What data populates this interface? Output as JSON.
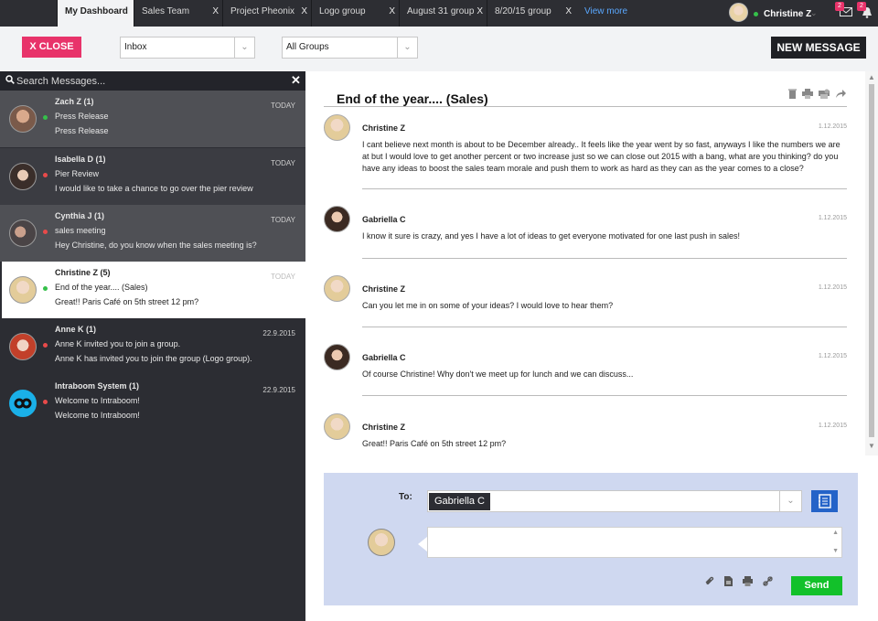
{
  "tabs": [
    {
      "label": "My Dashboard",
      "closable": false
    },
    {
      "label": "Sales Team",
      "close": "X"
    },
    {
      "label": "Project Pheonix",
      "close": "X"
    },
    {
      "label": "Logo group",
      "close": "X"
    },
    {
      "label": "August 31 group",
      "close": "X"
    },
    {
      "label": "8/20/15 group",
      "close": "X"
    }
  ],
  "view_more": "View more",
  "user": {
    "name": "Christine Z",
    "mail_count": "2",
    "notif_count": "2"
  },
  "toolbar": {
    "close_label": "X CLOSE",
    "folder_select": "Inbox",
    "group_select": "All Groups",
    "new_message_label": "NEW MESSAGE"
  },
  "search": {
    "placeholder": "Search Messages..."
  },
  "conversations": [
    {
      "name": "Zach Z (1)",
      "subject": "Press Release",
      "preview": "Press Release",
      "date": "TODAY",
      "status_color": "#35c04a"
    },
    {
      "name": "Isabella D (1)",
      "subject": "Pier Review",
      "preview": "I would like to take a chance to go over the pier review",
      "date": "TODAY",
      "status_color": "#e84a4a"
    },
    {
      "name": "Cynthia J (1)",
      "subject": "sales meeting",
      "preview": "Hey Christine, do you know when the sales meeting is?",
      "date": "TODAY",
      "status_color": "#e84a4a"
    },
    {
      "name": "Christine Z (5)",
      "subject": "End of the year.... (Sales)",
      "preview": "Great!! Paris Café on 5th street 12 pm?",
      "date": "TODAY",
      "status_color": "#35c04a"
    },
    {
      "name": "Anne K (1)",
      "subject": "Anne K invited you to join a group.",
      "preview": "Anne K has invited you to join the group (Logo group).",
      "date": "22.9.2015",
      "status_color": "#e84a4a"
    },
    {
      "name": "Intraboom System (1)",
      "subject": "Welcome to Intraboom!",
      "preview": "Welcome to Intraboom!",
      "date": "22.9.2015",
      "status_color": "#e84a4a"
    }
  ],
  "thread": {
    "title": "End of the year.... (Sales)",
    "messages": [
      {
        "name": "Christine Z",
        "date": "1.12.2015",
        "text": "I cant believe next month is about to be December already.. It feels like the year went by so fast, anyways I like the numbers we are at but I would love to get another percent or two increase just so we can close out 2015 with a bang, what are you thinking? do you have any ideas to boost the sales team morale and push them to work as hard as they can as the year comes to a close?"
      },
      {
        "name": "Gabriella C",
        "date": "1.12.2015",
        "text": "I know it sure is crazy, and yes I have a lot of ideas to get everyone motivated for one last push in sales!"
      },
      {
        "name": "Christine Z",
        "date": "1.12.2015",
        "text": "Can you let me in on some of your ideas? I would love to hear them?"
      },
      {
        "name": "Gabriella C",
        "date": "1.12.2015",
        "text": "Of course Christine! Why don't we meet up for lunch and we can discuss..."
      },
      {
        "name": "Christine Z",
        "date": "1.12.2015",
        "text": "Great!! Paris Café on 5th street 12 pm?"
      }
    ]
  },
  "compose": {
    "to_label": "To:",
    "recipient": "Gabriella C",
    "send_label": "Send"
  }
}
